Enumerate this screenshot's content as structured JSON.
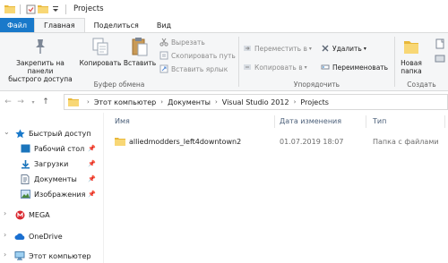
{
  "window": {
    "title": "Projects",
    "quick_access_toolbar": [
      "folder-icon",
      "properties-check-icon",
      "new-folder-icon",
      "customize-dropdown-icon"
    ]
  },
  "tabs": [
    {
      "label": "Файл"
    },
    {
      "label": "Главная"
    },
    {
      "label": "Поделиться"
    },
    {
      "label": "Вид"
    }
  ],
  "ribbon": {
    "clipboard": {
      "pin_label": "Закрепить на панели быстрого доступа",
      "pin_line1": "Закрепить на панели",
      "pin_line2": "быстрого доступа",
      "copy_label": "Копировать",
      "paste_label": "Вставить",
      "cut_label": "Вырезать",
      "copy_path_label": "Скопировать путь",
      "paste_shortcut_label": "Вставить ярлык",
      "group_label": "Буфер обмена"
    },
    "organize": {
      "move_to_label": "Переместить в",
      "copy_to_label": "Копировать в",
      "delete_label": "Удалить",
      "rename_label": "Переименовать",
      "group_label": "Упорядочить"
    },
    "create": {
      "new_folder_line1": "Новая",
      "new_folder_line2": "папка",
      "group_label": "Создать"
    }
  },
  "address": {
    "crumbs": [
      "Этот компьютер",
      "Документы",
      "Visual Studio 2012",
      "Projects"
    ]
  },
  "nav_pane": {
    "quick_access": "Быстрый доступ",
    "items": [
      {
        "label": "Рабочий стол",
        "icon": "desktop-icon"
      },
      {
        "label": "Загрузки",
        "icon": "downloads-icon"
      },
      {
        "label": "Документы",
        "icon": "documents-icon"
      },
      {
        "label": "Изображения",
        "icon": "pictures-icon"
      }
    ],
    "mega": "MEGA",
    "onedrive": "OneDrive",
    "this_pc": "Этот компьютер"
  },
  "columns": {
    "name": "Имя",
    "date": "Дата изменения",
    "type": "Тип"
  },
  "files": [
    {
      "name": "alliedmodders_left4downtown2",
      "date": "01.07.2019 18:07",
      "type": "Папка с файлами"
    }
  ],
  "colors": {
    "file_tab": "#1979ca",
    "folder": "#f8d775",
    "ribbon_bg": "#f5f6f7"
  }
}
